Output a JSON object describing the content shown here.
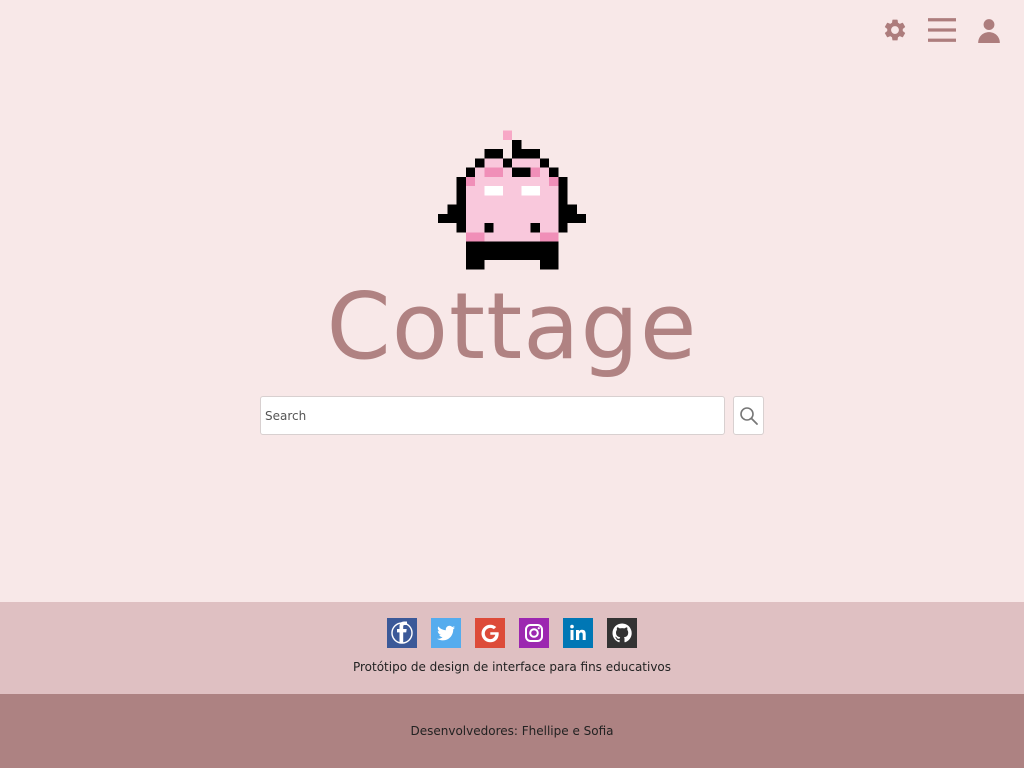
{
  "header": {
    "icons": [
      "gear-icon",
      "menu-icon",
      "user-icon"
    ],
    "icon_color": "#ad7d7d"
  },
  "brand": {
    "name": "Cottage",
    "color": "#b08282"
  },
  "search": {
    "placeholder": "Search",
    "value": "",
    "button_icon": "search-icon"
  },
  "footer": {
    "socials": [
      {
        "name": "facebook",
        "color": "#3b5998"
      },
      {
        "name": "twitter",
        "color": "#55acee"
      },
      {
        "name": "google",
        "color": "#dd4b39"
      },
      {
        "name": "instagram",
        "color": "#9c27b0"
      },
      {
        "name": "linkedin",
        "color": "#0077b5"
      },
      {
        "name": "github",
        "color": "#333333"
      }
    ],
    "note": "Protótipo de design de interface para fins educativos",
    "developers": "Desenvolvedores: Fhellipe e Sofia",
    "colors": {
      "top": "#dfc0c2",
      "bottom": "#ad8282"
    }
  },
  "background": "#f8e8e8"
}
